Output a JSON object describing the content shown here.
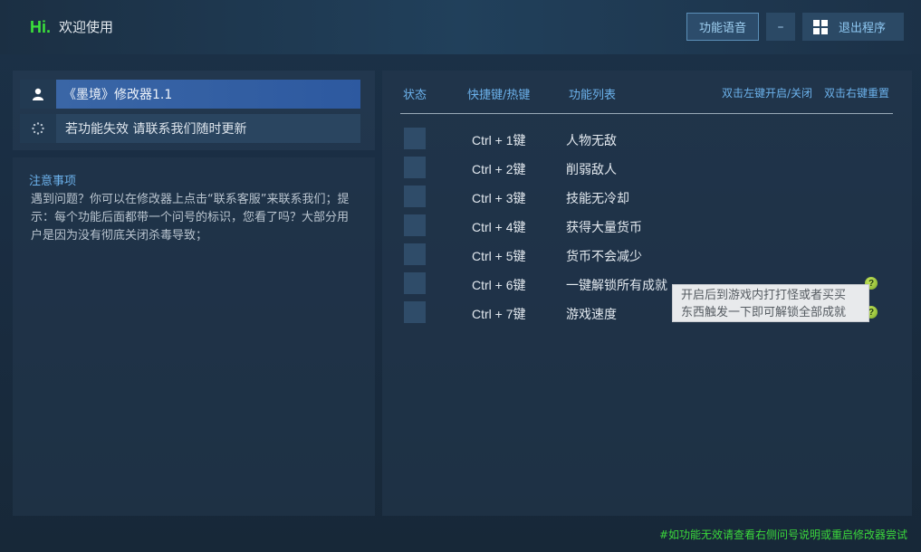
{
  "header": {
    "hi": "Hi.",
    "welcome": "欢迎使用",
    "voice_button": "功能语音",
    "minimize_label": "–",
    "exit_button": "退出程序"
  },
  "left": {
    "title": "《墨境》修改器1.1",
    "update_note": "若功能失效  请联系我们随时更新",
    "notice_title": "注意事项",
    "notice_body": "遇到问题？你可以在修改器上点击“联系客服”来联系我们；提示：每个功能后面都带一个问号的标识，您看了吗？大部分用户是因为没有彻底关闭杀毒导致；"
  },
  "table": {
    "col_status": "状态",
    "col_hotkey": "快捷键/热键",
    "col_features": "功能列表",
    "hint_left": "双击左键开启/关闭",
    "hint_right": "双击右键重置",
    "rows": [
      {
        "key": "Ctrl  +  1键",
        "name": "人物无敌",
        "help": false
      },
      {
        "key": "Ctrl  +  2键",
        "name": "削弱敌人",
        "help": false
      },
      {
        "key": "Ctrl  +  3键",
        "name": "技能无冷却",
        "help": false
      },
      {
        "key": "Ctrl  +  4键",
        "name": "获得大量货币",
        "help": false
      },
      {
        "key": "Ctrl  +  5键",
        "name": "货币不会减少",
        "help": false
      },
      {
        "key": "Ctrl  +  6键",
        "name": "一键解锁所有成就",
        "help": true
      },
      {
        "key": "Ctrl  +  7键",
        "name": "游戏速度",
        "help": true
      }
    ],
    "qmark_symbol": "?"
  },
  "tooltip": {
    "line1": "开启后到游戏内打打怪或者买买",
    "line2": "东西触发一下即可解锁全部成就"
  },
  "footer": "#如功能无效请查看右侧问号说明或重启修改器尝试",
  "colors": {
    "accent_green": "#3be03b",
    "accent_blue": "#6cb2ec",
    "title_bar": "#3a66a6"
  }
}
